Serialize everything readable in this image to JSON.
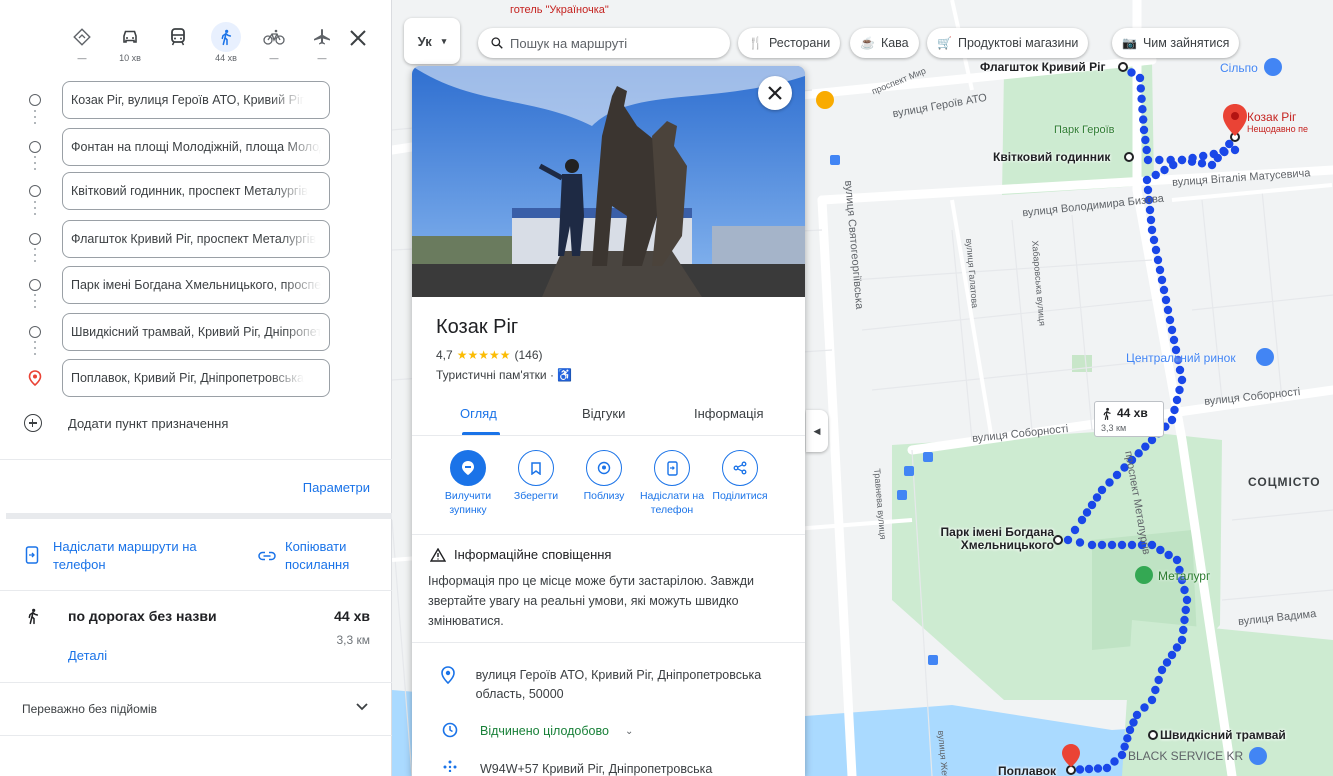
{
  "travel_modes": [
    {
      "name": "best",
      "time": "—"
    },
    {
      "name": "car",
      "time": "10 хв"
    },
    {
      "name": "transit",
      "time": ""
    },
    {
      "name": "walk",
      "time": "44 хв"
    },
    {
      "name": "bicycle",
      "time": "—"
    },
    {
      "name": "flight",
      "time": "—"
    }
  ],
  "waypoints": [
    "Козак Ріг, вулиця Героїв АТО, Кривий Ріг",
    "Фонтан на площі Молодіжній, площа Молодіжна",
    "Квітковий годинник, проспект Металургів",
    "Флагшток Кривий Ріг, проспект Металургів",
    "Парк імені Богдана Хмельницького, проспект",
    "Швидкісний трамвай, Кривий Ріг, Дніпропетровська",
    "Поплавок, Кривий Ріг, Дніпропетровська"
  ],
  "add_destination": "Додати пункт призначення",
  "parameters": "Параметри",
  "send_routes": "Надіслати маршрути на телефон",
  "copy_link": "Копіювати посилання",
  "route": {
    "name": "по дорогах без назви",
    "time": "44 хв",
    "distance": "3,3 км",
    "details": "Деталі",
    "note": "Переважно без підйомів"
  },
  "map_top": {
    "lang": "Ук",
    "search_placeholder": "Пошук на маршруті",
    "chips": [
      "Ресторани",
      "Кава",
      "Продуктові магазини",
      "Чим зайнятися"
    ]
  },
  "card": {
    "title": "Козак Ріг",
    "rating": "4,7",
    "stars": "★★★★★",
    "reviews": "(146)",
    "category": "Туристичні пам'ятки ·",
    "tabs": [
      "Огляд",
      "Відгуки",
      "Інформація"
    ],
    "actions": [
      "Вилучити зупинку",
      "Зберегти",
      "Поблизу",
      "Надіслати на телефон",
      "Поділитися"
    ],
    "warning_title": "Інформаційне сповіщення",
    "warning_text": "Інформація про це місце може бути застарілою. Завжди звертайте увагу на реальні умови, які можуть швидко змінюватися.",
    "address": "вулиця Героїв АТО, Кривий Ріг, Дніпропетровська область, 50000",
    "hours": "Відчинено цілодобово",
    "plus_code": "W94W+57 Кривий Ріг, Дніпропетровська"
  },
  "map_labels": {
    "hotel": "готель \"Україночка\"",
    "flagpole": "Флагшток Кривий Ріг",
    "flower_clock": "Квітковий годинник",
    "park_heroes": "Парк Героїв",
    "kozak_rig": "Козак Ріг",
    "recently_viewed": "Нещодавно пе",
    "silpo": "Сільпо",
    "central_market": "Центральний ринок",
    "sotsmisto": "СОЦМІСТО",
    "park_khmel": "Парк імені Богдана Хмельницького",
    "metalurh": "Металург",
    "tram": "Швидкісний трамвай",
    "black_service": "BLACK SERVICE KR",
    "poplavok": "Поплавок",
    "st_heroes": "вулиця Героїв АТО",
    "st_bizova": "вулиця Володимира Бизова",
    "st_matusevych": "вулиця Віталія Матусевича",
    "st_sobornosti": "вулиця Соборності",
    "st_sobornosti2": "вулиця Соборності",
    "st_metalurhiv": "проспект Металургів",
    "st_svyatogeor": "вулиця Святогеоргіївська",
    "st_galatova": "вулиця Галатова",
    "st_khabarov": "Хабаровська вулиця",
    "st_travneva": "Травнева вулиця",
    "st_vadym": "вулиця Вадима",
    "st_zhenka": "вулиця Женка",
    "st_mir": "проспект Мир"
  },
  "callout": {
    "time": "44 хв",
    "distance": "3,3 км"
  },
  "colors": {
    "accent": "#1a73e8",
    "route": "#1a47e8",
    "park": "#cdebd1",
    "pin": "#ea4335"
  }
}
